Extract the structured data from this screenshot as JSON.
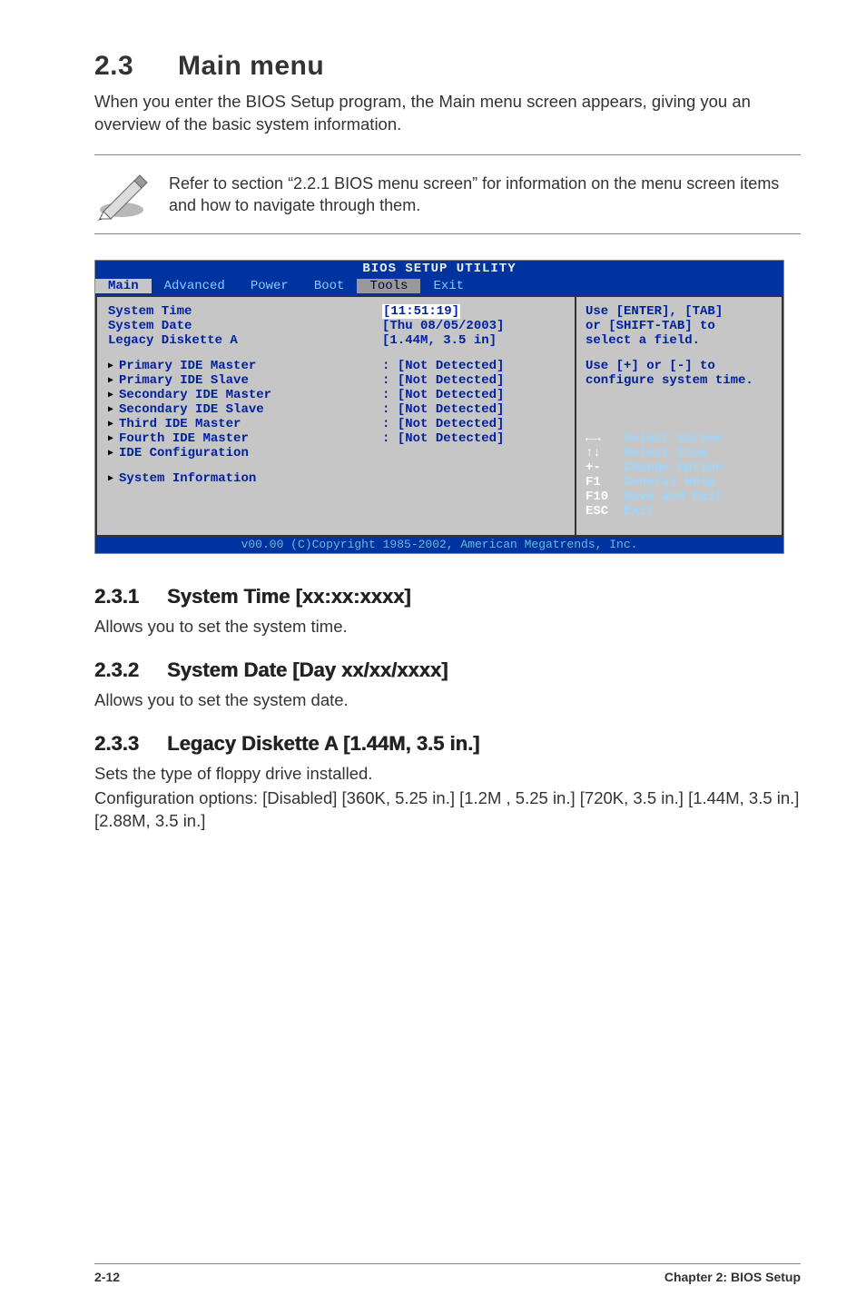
{
  "doc": {
    "section_number": "2.3",
    "section_title": "Main menu",
    "intro": "When you enter the BIOS Setup program, the Main menu screen appears, giving you an overview of the basic system information.",
    "note": "Refer to section “2.2.1  BIOS menu screen” for information on the menu screen items and how to navigate through them."
  },
  "bios": {
    "title": "BIOS SETUP UTILITY",
    "tabs": {
      "main": "Main",
      "advanced": "Advanced",
      "power": "Power",
      "boot": "Boot",
      "tools": "Tools",
      "exit": "Exit"
    },
    "fields": {
      "system_time": {
        "label": "System Time",
        "value": "[11:51:19]"
      },
      "system_date": {
        "label": "System Date",
        "value": "[Thu 08/05/2003]"
      },
      "legacy_a": {
        "label": "Legacy Diskette A",
        "value": "[1.44M, 3.5 in]"
      },
      "pri_master": {
        "label": "Primary IDE Master",
        "value": "[Not Detected]"
      },
      "pri_slave": {
        "label": "Primary IDE Slave",
        "value": "[Not Detected]"
      },
      "sec_master": {
        "label": "Secondary IDE Master",
        "value": "[Not Detected]"
      },
      "sec_slave": {
        "label": "Secondary IDE Slave",
        "value": "[Not Detected]"
      },
      "third": {
        "label": "Third IDE Master",
        "value": "[Not Detected]"
      },
      "fourth": {
        "label": "Fourth IDE Master",
        "value": "[Not Detected]"
      },
      "ide_cfg": {
        "label": "IDE Configuration"
      },
      "sys_info": {
        "label": "System Information"
      }
    },
    "help1_l1": "Use [ENTER], [TAB]",
    "help1_l2": "or [SHIFT-TAB] to",
    "help1_l3": "select a field.",
    "help2_l1": "Use [+] or [-] to",
    "help2_l2": "configure system time.",
    "keys": {
      "arrows_lr": {
        "key": "←→",
        "desc": "Select Screen"
      },
      "arrows_ud": {
        "key": "↑↓",
        "desc": "Select Item"
      },
      "plusminus": {
        "key": "+-",
        "desc": "Change Option"
      },
      "f1": {
        "key": "F1",
        "desc": "General Help"
      },
      "f10": {
        "key": "F10",
        "desc": "Save and Exit"
      },
      "esc": {
        "key": "ESC",
        "desc": "Exit"
      }
    },
    "footer": "v00.00 (C)Copyright 1985-2002, American Megatrends, Inc."
  },
  "subs": {
    "s1": {
      "num": "2.3.1",
      "title": "System Time [xx:xx:xxxx]",
      "text": "Allows you to set the system time."
    },
    "s2": {
      "num": "2.3.2",
      "title": "System Date [Day xx/xx/xxxx]",
      "text": "Allows you to set the system date."
    },
    "s3": {
      "num": "2.3.3",
      "title": "Legacy Diskette A [1.44M, 3.5 in.]",
      "text_l1": "Sets the type of floppy drive installed.",
      "text_l2": "Configuration options: [Disabled] [360K, 5.25 in.] [1.2M , 5.25 in.] [720K, 3.5 in.] [1.44M, 3.5 in.] [2.88M, 3.5 in.]"
    }
  },
  "page_footer": {
    "left": "2-12",
    "right": "Chapter 2: BIOS Setup"
  }
}
